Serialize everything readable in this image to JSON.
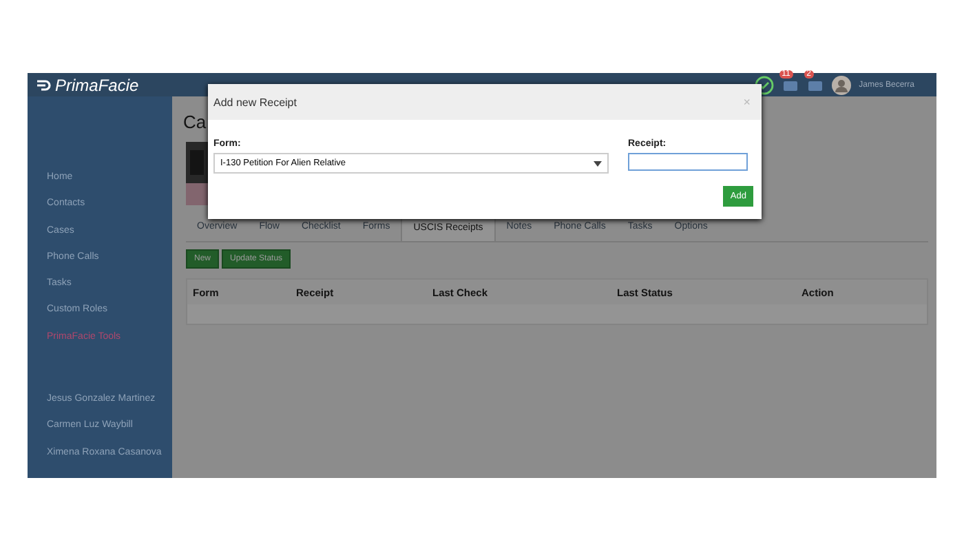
{
  "brand": "PrimaFacie",
  "header": {
    "notifications": [
      {
        "count": "11",
        "color": "#d9534f"
      },
      {
        "count": "2",
        "color": "#d9534f"
      }
    ],
    "user": "James Becerra"
  },
  "sidebar": {
    "items": [
      {
        "label": "Home",
        "selected": false
      },
      {
        "label": "Contacts",
        "selected": false
      },
      {
        "label": "Cases",
        "selected": false
      },
      {
        "label": "Phone Calls",
        "selected": false
      },
      {
        "label": "Tasks",
        "selected": false
      },
      {
        "label": "Custom Roles",
        "selected": false
      },
      {
        "label": "PrimaFacie Tools",
        "selected": true
      }
    ],
    "recent": [
      "Jesus Gonzalez Martinez",
      "Carmen Luz Waybill",
      "Ximena Roxana Casanova"
    ]
  },
  "page_title": "Ca",
  "tabs": [
    {
      "label": "Overview",
      "selected": false
    },
    {
      "label": "Flow",
      "selected": false
    },
    {
      "label": "Checklist",
      "selected": false
    },
    {
      "label": "Forms",
      "selected": false
    },
    {
      "label": "USCIS Receipts",
      "selected": true
    },
    {
      "label": "Notes",
      "selected": false
    },
    {
      "label": "Phone Calls",
      "selected": false
    },
    {
      "label": "Tasks",
      "selected": false
    },
    {
      "label": "Options",
      "selected": false
    }
  ],
  "actions": [
    "New",
    "Update Status"
  ],
  "table": {
    "columns": [
      "Form",
      "Receipt",
      "Last Check",
      "Last Status",
      "Action"
    ]
  },
  "dialog": {
    "title": "Add new Receipt",
    "close": "×",
    "form_label": "Form:",
    "form_value": "I-130 Petition For Alien Relative",
    "receipt_label": "Receipt:",
    "button": "Add"
  }
}
